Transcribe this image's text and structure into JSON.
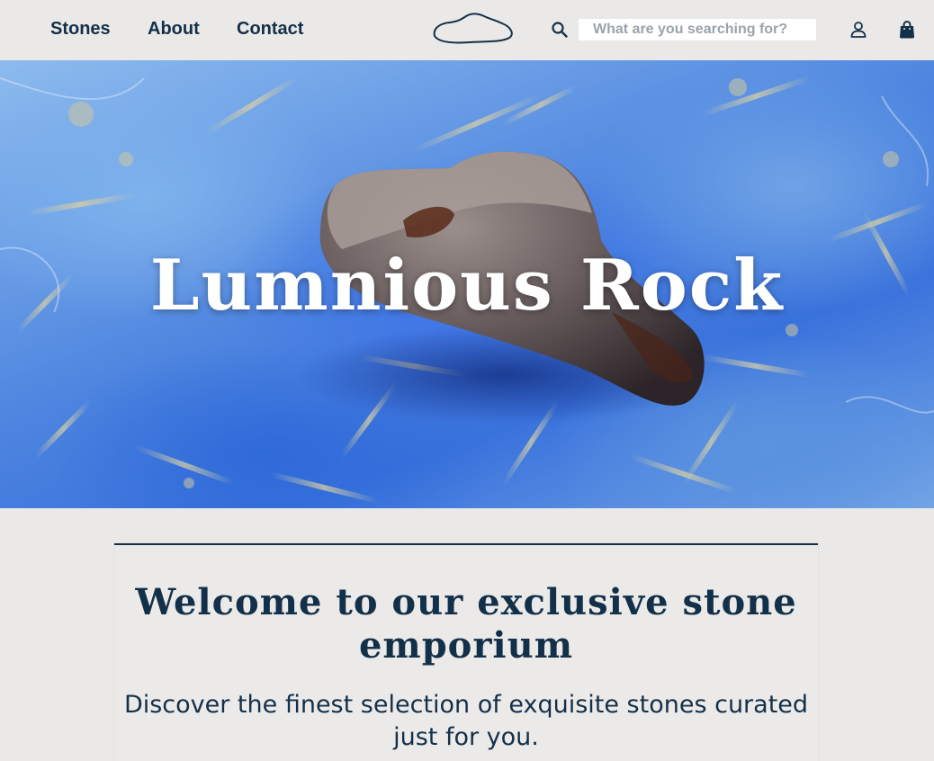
{
  "nav": {
    "links": [
      {
        "label": "Stones"
      },
      {
        "label": "About"
      },
      {
        "label": "Contact"
      }
    ]
  },
  "logo": {
    "icon": "stone-outline-logo"
  },
  "search": {
    "icon": "search-icon",
    "placeholder": "What are you searching for?",
    "value": ""
  },
  "account": {
    "icon": "user-icon"
  },
  "cart": {
    "icon": "shopping-bag-icon"
  },
  "hero": {
    "title": "Lumnious Rock",
    "image": "stone-on-blue-crystal-background"
  },
  "welcome": {
    "title": "Welcome to our exclusive stone emporium",
    "subtitle": "Discover the finest selection of exquisite stones curated just for you."
  },
  "colors": {
    "primary": "#13304a",
    "background": "#ebe9e7",
    "hero_blue": "#3f74e8",
    "white": "#ffffff"
  }
}
